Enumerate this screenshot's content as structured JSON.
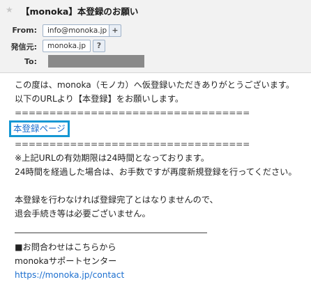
{
  "header": {
    "subject": "【monoka】本登録のお願い",
    "from_label": "From:",
    "from_value": "info@monoka.jp",
    "sender_label": "発信元:",
    "sender_value": "monoka.jp",
    "to_label": "To:",
    "add_symbol": "+",
    "help_symbol": "?"
  },
  "body": {
    "line1": "この度は、monoka（モノカ）へ仮登録いただきありがとうございます。",
    "line2": "以下のURLより【本登録】をお願いします。",
    "separator1": "==================================",
    "link_label": "本登録ページ",
    "separator2": "==================================",
    "note1": "※上記URLの有効期限は24時間となっております。",
    "note2": "24時間を経過した場合は、お手数ですが再度新規登録を行ってください。",
    "para1": "本登録を行わなければ登録完了とはなりませんので、",
    "para2": "退会手続き等は必要ございません。",
    "contact_heading": "■お問合わせはこちらから",
    "support_center": "monokaサポートセンター",
    "contact_url": "https://monoka.jp/contact"
  }
}
